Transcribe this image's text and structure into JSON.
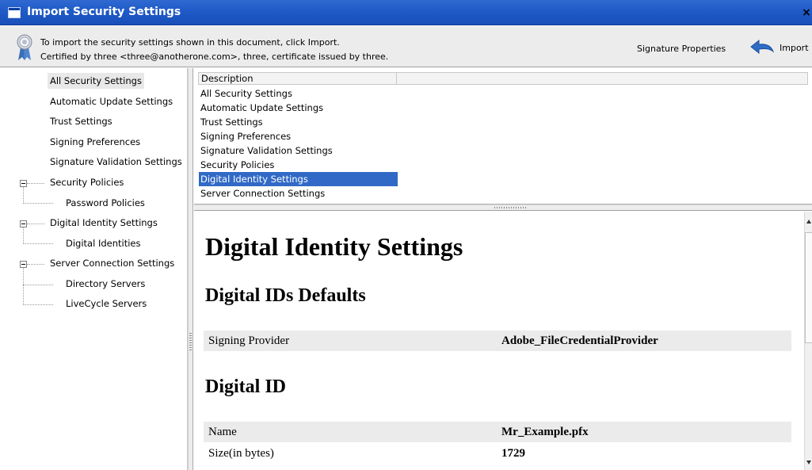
{
  "window": {
    "title": "Import Security Settings",
    "close_label": "×"
  },
  "infobar": {
    "line1": "To import the security settings shown in this document, click Import.",
    "line2": "Certified by three <three@anotherone.com>, three, certificate issued by three.",
    "signature_properties": "Signature Properties",
    "import_label": "Import",
    "icons": {
      "certificate": "certificate-ribbon-icon",
      "import": "import-arrow-icon"
    }
  },
  "tree": {
    "items": [
      {
        "label": "All Security Settings",
        "selected": true
      },
      {
        "label": "Automatic Update Settings"
      },
      {
        "label": "Trust Settings"
      },
      {
        "label": "Signing Preferences"
      },
      {
        "label": "Signature Validation Settings"
      },
      {
        "label": "Security Policies",
        "expanded": true
      },
      {
        "label": "Password Policies",
        "child": true
      },
      {
        "label": "Digital Identity Settings",
        "expanded": true
      },
      {
        "label": "Digital Identities",
        "child": true
      },
      {
        "label": "Server Connection Settings",
        "expanded": true
      },
      {
        "label": "Directory Servers",
        "child": true
      },
      {
        "label": "LiveCycle Servers",
        "child": true
      }
    ]
  },
  "list": {
    "column_header": "Description",
    "rows": [
      "All Security Settings",
      "Automatic Update Settings",
      "Trust Settings",
      "Signing Preferences",
      "Signature Validation Settings",
      "Security Policies",
      "Digital Identity Settings",
      "Server Connection Settings"
    ],
    "selected_index": 6
  },
  "detail": {
    "heading": "Digital Identity Settings",
    "section1": {
      "title": "Digital IDs Defaults",
      "rows": [
        {
          "key": "Signing Provider",
          "value": "Adobe_FileCredentialProvider"
        }
      ]
    },
    "section2": {
      "title": "Digital ID",
      "rows": [
        {
          "key": "Name",
          "value": "Mr_Example.pfx"
        },
        {
          "key": "Size(in bytes)",
          "value": "1729"
        }
      ]
    }
  },
  "colors": {
    "titlebar": "#1f5ac8",
    "selection": "#3169c6",
    "shaded_row": "#ebebeb"
  }
}
